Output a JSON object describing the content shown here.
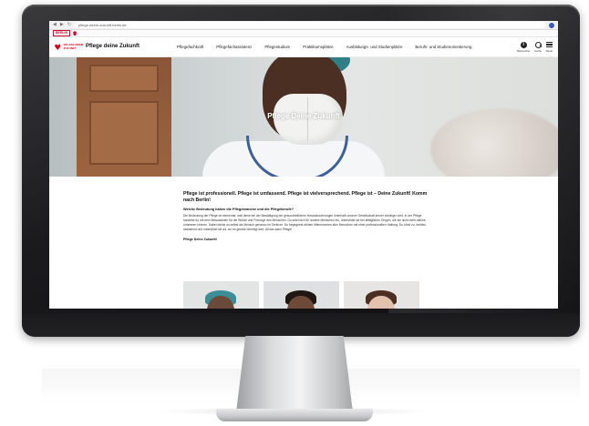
{
  "browser": {
    "url": "pflege-deine-zukunft.berlin.de",
    "tab_label": "BERLIN"
  },
  "site": {
    "logo_text": "SPLASS DEINE ZUKUNFT",
    "title": "Pflege deine Zukunft",
    "nav": [
      "Pflegefachkraft",
      "Pflegefachassistenz",
      "Pflegestudium",
      "Praktikumsplätze",
      "Ausbildungs- und Studienplätze",
      "Berufs- und Studienorientierung"
    ],
    "utility": {
      "info_label": "Barrierefrei",
      "search_label": "Suche",
      "menu_label": "Menü",
      "info_glyph": "i"
    }
  },
  "hero": {
    "title": "Pflege Deine Zukunft"
  },
  "content": {
    "lead": "Pflege ist professionell. Pflege ist umfassend. Pflege ist vielversprechend. Pflege ist – Deine Zukunft! Komm nach Berlin!",
    "subhead": "Welche Bedeutung haben die Pflegebranche und die Pflegeberufe?",
    "body": "Die Bedeutung der Pflege ist elementar, weil diese bei der Bewältigung der gesundheitlichen Herausforderungen innerhalb unserer Gesellschaft immer wichtiger wird. In der Pflege handelst du mit dem Bewusstsein für die Würde und Fürsorge des Menschen. Du setzt dich für andere Menschen ein, unterstützt sie bei alltäglichen Dingen, die sie nicht mehr alleine umsetzen können. Dabei stehst du selbst als Mensch genauso im Zentrum: Du begegnest deinen Mitmenschen aller Menschen mit einer professionellen Haltung. Du hörst zu, berätst, assistierst und unterstützt sie da, wo es gerade benötigt wird. All das kann Pflege!",
    "signoff": "Pflege Deine Zukunft!"
  },
  "colors": {
    "brand_red": "#d0021b",
    "berlin_red": "#c8102e",
    "bezel": "#1b1b1d"
  }
}
